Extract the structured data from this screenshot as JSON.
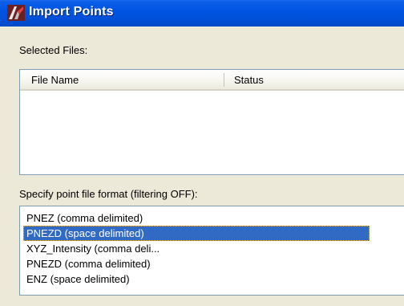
{
  "window": {
    "title": "Import Points",
    "icon": "autocad-logo-icon"
  },
  "selected_files": {
    "label": "Selected Files:",
    "columns": [
      "File Name",
      "Status"
    ],
    "rows": []
  },
  "format": {
    "label": "Specify point file format (filtering OFF):",
    "items": [
      "PNEZ (comma delimited)",
      "PNEZD (space delimited)",
      "XYZ_Intensity (comma deli...",
      "PNEZD (comma delimited)",
      "ENZ (space delimited)"
    ],
    "selected": "PNEZD (space delimited)"
  },
  "colors": {
    "title_bar": "#0054e3",
    "selection": "#316ac5",
    "dialog_bg": "#ece9d8"
  }
}
